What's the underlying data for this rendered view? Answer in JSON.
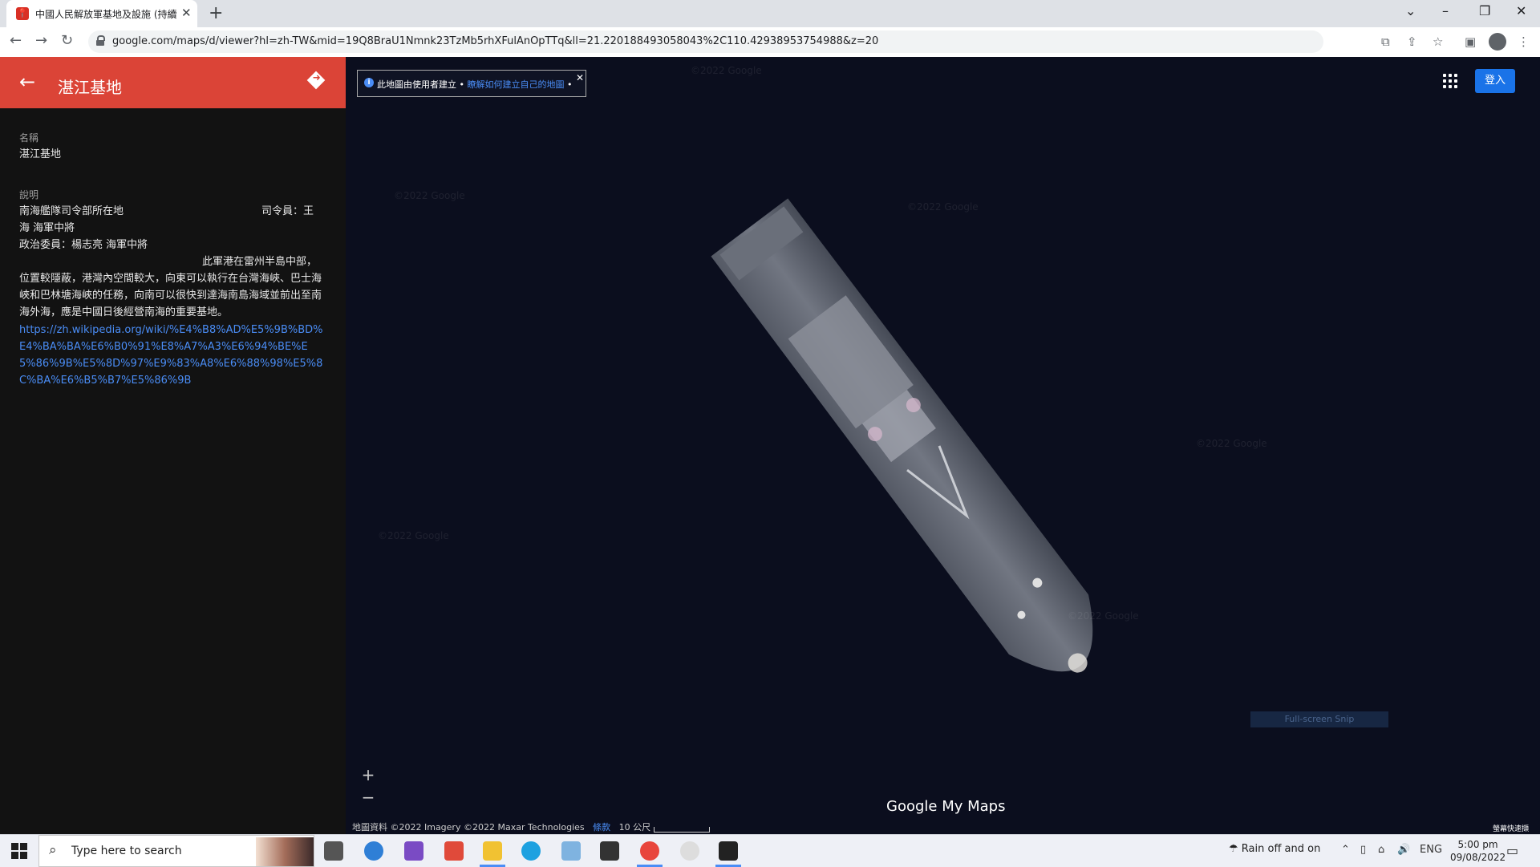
{
  "browser": {
    "tab_title": "中國人民解放軍基地及設施 (持續…",
    "url": "google.com/maps/d/viewer?hl=zh-TW&mid=19Q8BraU1Nmnk23TzMb5rhXFulAnOpTTq&ll=21.220188493058043%2C110.42938953754988&z=20"
  },
  "sidepanel": {
    "title": "湛江基地",
    "name_label": "名稱",
    "name_value": "湛江基地",
    "desc_label": "說明",
    "desc_line1a": "南海艦隊司令部所在地",
    "desc_line1b": "司令員：王",
    "desc_line2": "海 海軍中將",
    "desc_line3": "政治委員：楊志亮 海軍中將",
    "desc_line4": "此軍港在雷州半島中部，",
    "desc_para": "位置較隱蔽，港灣內空間較大，向東可以執行在台灣海峽、巴士海峽和巴林塘海峽的任務，向南可以很快到達海南島海域並前出至南海外海，應是中國日後經營南海的重要基地。",
    "desc_link": "https://zh.wikipedia.org/wiki/%E4%B8%AD%E5%9B%BD%E4%BA%BA%E6%B0%91%E8%A7%A3%E6%94%BE%E5%86%9B%E5%8D%97%E9%83%A8%E6%88%98%E5%8C%BA%E6%B5%B7%E5%86%9B"
  },
  "map": {
    "info_text": "此地圖由使用者建立 •",
    "info_link": "瞭解如何建立自己的地圖",
    "info_suffix": "•",
    "signin_label": "登入",
    "zoom_in": "+",
    "zoom_out": "−",
    "brand_google": "Google",
    "brand_mymaps": " My Maps",
    "footer_data": "地圖資料 ©2022 Imagery ©2022 Maxar Technologies",
    "footer_terms": "條款",
    "scale_label": "10 公尺",
    "snip_label": "Full-screen Snip",
    "corner_label": "螢幕快速擷",
    "watermark": "©2022 Google"
  },
  "taskbar": {
    "search_placeholder": "Type here to search",
    "weather": "Rain off and on",
    "lang": "ENG",
    "time": "5:00 pm",
    "date": "09/08/2022"
  }
}
